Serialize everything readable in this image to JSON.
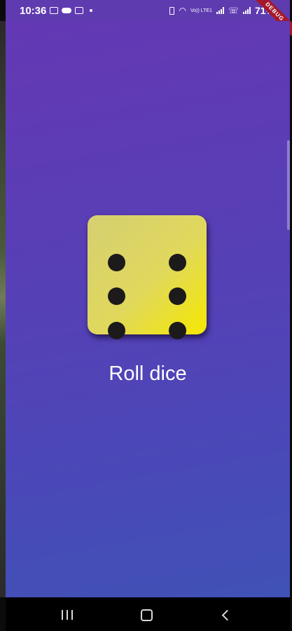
{
  "status_bar": {
    "time": "10:36",
    "volte_label": "Vo)) LTE1",
    "battery": "71%"
  },
  "debug_banner": {
    "label": "DEBUG"
  },
  "dice": {
    "face_value": 6,
    "colors": {
      "face_light": "#d5cf72",
      "face_bright": "#f6e800",
      "pip": "#1c1a1a"
    }
  },
  "main": {
    "roll_label": "Roll dice"
  },
  "theme": {
    "gradient_top": "#6438b4",
    "gradient_bottom": "#4052b6",
    "text": "#ffffff"
  },
  "nav_bar": {
    "buttons": [
      "recents-icon",
      "home-icon",
      "back-icon"
    ]
  }
}
